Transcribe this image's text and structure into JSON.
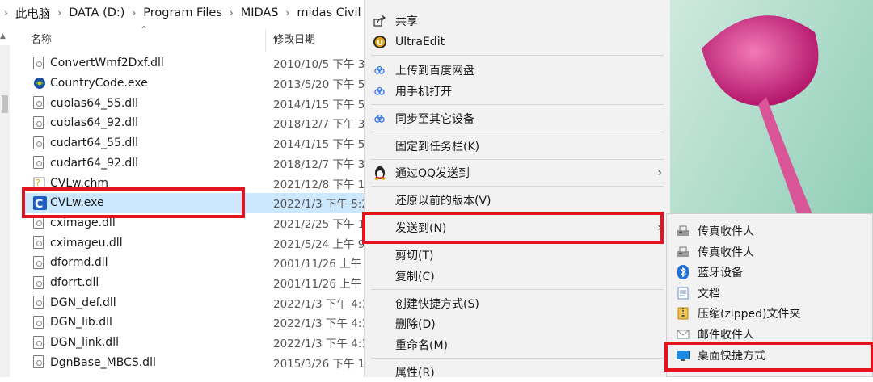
{
  "breadcrumb": [
    "此电脑",
    "DATA (D:)",
    "Program Files",
    "MIDAS",
    "midas Civil"
  ],
  "breadcrumb_separator": "›",
  "columns": {
    "name": "名称",
    "date": "修改日期"
  },
  "files": [
    {
      "name": "ConvertWmf2Dxf.dll",
      "date": "2010/10/5 下午 3",
      "icon": "dll-file-icon"
    },
    {
      "name": "CountryCode.exe",
      "date": "2013/5/20 下午 5",
      "icon": "exe-app-icon"
    },
    {
      "name": "cublas64_55.dll",
      "date": "2014/1/15 下午 5",
      "icon": "dll-file-icon"
    },
    {
      "name": "cublas64_92.dll",
      "date": "2018/12/7 下午 3",
      "icon": "dll-file-icon"
    },
    {
      "name": "cudart64_55.dll",
      "date": "2014/1/15 下午 5",
      "icon": "dll-file-icon"
    },
    {
      "name": "cudart64_92.dll",
      "date": "2018/12/7 下午 3",
      "icon": "dll-file-icon"
    },
    {
      "name": "CVLw.chm",
      "date": "2021/12/8 下午 1",
      "icon": "help-file-icon"
    },
    {
      "name": "CVLw.exe",
      "date": "2022/1/3 下午 5:2",
      "icon": "civil-app-icon",
      "selected": true
    },
    {
      "name": "cximage.dll",
      "date": "2021/2/25 下午 1",
      "icon": "dll-file-icon"
    },
    {
      "name": "cximageu.dll",
      "date": "2021/5/24 上午 9",
      "icon": "dll-file-icon"
    },
    {
      "name": "dformd.dll",
      "date": "2001/11/26 上午",
      "icon": "dll-file-icon"
    },
    {
      "name": "dforrt.dll",
      "date": "2001/11/26 上午",
      "icon": "dll-file-icon"
    },
    {
      "name": "DGN_def.dll",
      "date": "2022/1/3 下午 4:1",
      "icon": "dll-file-icon"
    },
    {
      "name": "DGN_lib.dll",
      "date": "2022/1/3 下午 4:1",
      "icon": "dll-file-icon"
    },
    {
      "name": "DGN_link.dll",
      "date": "2022/1/3 下午 4:1",
      "icon": "dll-file-icon"
    },
    {
      "name": "DgnBase_MBCS.dll",
      "date": "2015/3/26 下午 1",
      "icon": "dll-file-icon"
    }
  ],
  "context_menu": {
    "items": [
      {
        "label": "共享",
        "icon": "share-icon",
        "submenu": false
      },
      {
        "label": "UltraEdit",
        "icon": "ultraedit-icon",
        "submenu": false
      },
      {
        "label": "上传到百度网盘",
        "icon": "baidu-cloud-icon",
        "submenu": false
      },
      {
        "label": "用手机打开",
        "icon": "baidu-cloud-icon",
        "submenu": false
      },
      {
        "label": "同步至其它设备",
        "icon": "baidu-cloud-icon",
        "submenu": false
      },
      {
        "label": "固定到任务栏(K)",
        "icon": "",
        "submenu": false
      },
      {
        "label": "通过QQ发送到",
        "icon": "qq-penguin-icon",
        "submenu": true
      },
      {
        "label": "还原以前的版本(V)",
        "icon": "",
        "submenu": false
      },
      {
        "label": "发送到(N)",
        "icon": "",
        "submenu": true,
        "highlighted": true
      },
      {
        "label": "剪切(T)",
        "icon": "",
        "submenu": false
      },
      {
        "label": "复制(C)",
        "icon": "",
        "submenu": false
      },
      {
        "label": "创建快捷方式(S)",
        "icon": "",
        "submenu": false
      },
      {
        "label": "删除(D)",
        "icon": "",
        "submenu": false
      },
      {
        "label": "重命名(M)",
        "icon": "",
        "submenu": false
      },
      {
        "label": "属性(R)",
        "icon": "",
        "submenu": false
      }
    ]
  },
  "send_to_menu": {
    "items": [
      {
        "label": "传真收件人",
        "icon": "fax-icon"
      },
      {
        "label": "传真收件人",
        "icon": "fax-icon"
      },
      {
        "label": "蓝牙设备",
        "icon": "bluetooth-icon"
      },
      {
        "label": "文档",
        "icon": "document-icon"
      },
      {
        "label": "压缩(zipped)文件夹",
        "icon": "zip-folder-icon"
      },
      {
        "label": "邮件收件人",
        "icon": "mail-icon"
      },
      {
        "label": "桌面快捷方式",
        "icon": "desktop-icon",
        "highlighted": true
      }
    ]
  },
  "colors": {
    "highlight_box": "#e3141d",
    "selection": "#cce8ff",
    "menu_bg": "#f2f2f2"
  }
}
